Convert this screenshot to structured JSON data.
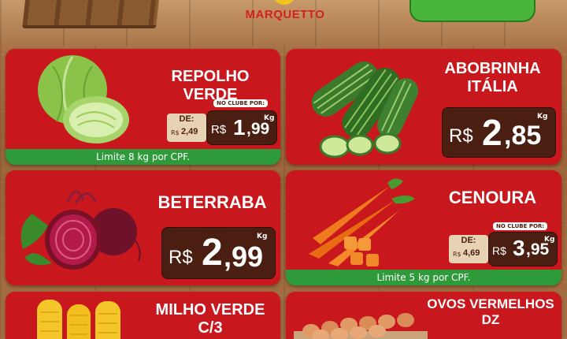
{
  "brand": {
    "name": "MARQUETTO"
  },
  "products": {
    "repolho": {
      "name": "REPOLHO VERDE",
      "club_label": "NO CLUBE POR:",
      "de_label": "DE:",
      "de_currency": "R$",
      "de_value": "2,49",
      "currency": "R$",
      "price_int": "1",
      "price_dec": ",99",
      "unit": "Kg",
      "limit": "Limite 8 kg por CPF."
    },
    "abobrinha": {
      "name_line1": "ABOBRINHA",
      "name_line2": "ITÁLIA",
      "currency": "R$",
      "price_int": "2",
      "price_dec": ",85",
      "unit": "Kg"
    },
    "beterraba": {
      "name": "BETERRABA",
      "currency": "R$",
      "price_int": "2",
      "price_dec": ",99",
      "unit": "Kg"
    },
    "cenoura": {
      "name": "CENOURA",
      "club_label": "NO CLUBE POR:",
      "de_label": "DE:",
      "de_currency": "R$",
      "de_value": "4,69",
      "currency": "R$",
      "price_int": "3",
      "price_dec": ",95",
      "unit": "Kg",
      "limit": "Limite 5 kg por CPF."
    },
    "milho": {
      "name_line1": "MILHO VERDE",
      "name_line2": "C/3"
    },
    "ovos": {
      "name_line1": "OVOS VERMELHOS",
      "name_line2": "DZ"
    }
  },
  "colors": {
    "card_red": "#c8171d",
    "price_brown": "#4a1e10",
    "limit_green": "#2f9a3a",
    "wood": "#9a6538"
  }
}
